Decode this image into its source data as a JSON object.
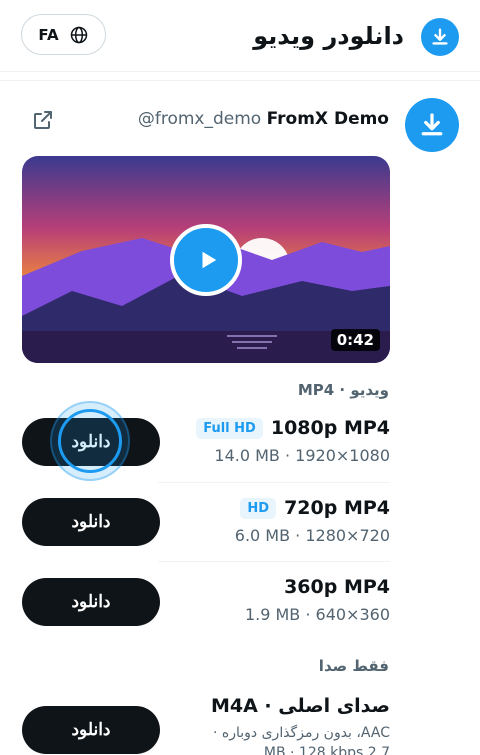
{
  "header": {
    "lang_label": "FA",
    "title": "دانلودر ویدیو",
    "icon": "download-icon"
  },
  "author": {
    "name": "FromX Demo",
    "handle": "@fromx_demo",
    "external_icon": "external-link-icon"
  },
  "video": {
    "duration": "0:42"
  },
  "video_section": {
    "label": "ویدیو · MP4"
  },
  "formats": [
    {
      "title": "1080p MP4",
      "badge": "Full HD",
      "meta": "14.0 MB · 1920×1080",
      "button": "دانلود"
    },
    {
      "title": "720p MP4",
      "badge": "HD",
      "meta": "6.0 MB · 1280×720",
      "button": "دانلود"
    },
    {
      "title": "360p MP4",
      "badge": "",
      "meta": "1.9 MB · 640×360",
      "button": "دانلود"
    }
  ],
  "audio_section": {
    "label": "فقط صدا"
  },
  "audio": {
    "title": "صدای اصلی · M4A",
    "meta_line1": "AAC، بدون رمزگذاری دوباره ·",
    "meta_line2": "2.7 MB · 128 kbps",
    "button": "دانلود"
  },
  "colors": {
    "accent": "#1d9bf0",
    "button_dark": "#0f1419",
    "muted_text": "#536471"
  }
}
